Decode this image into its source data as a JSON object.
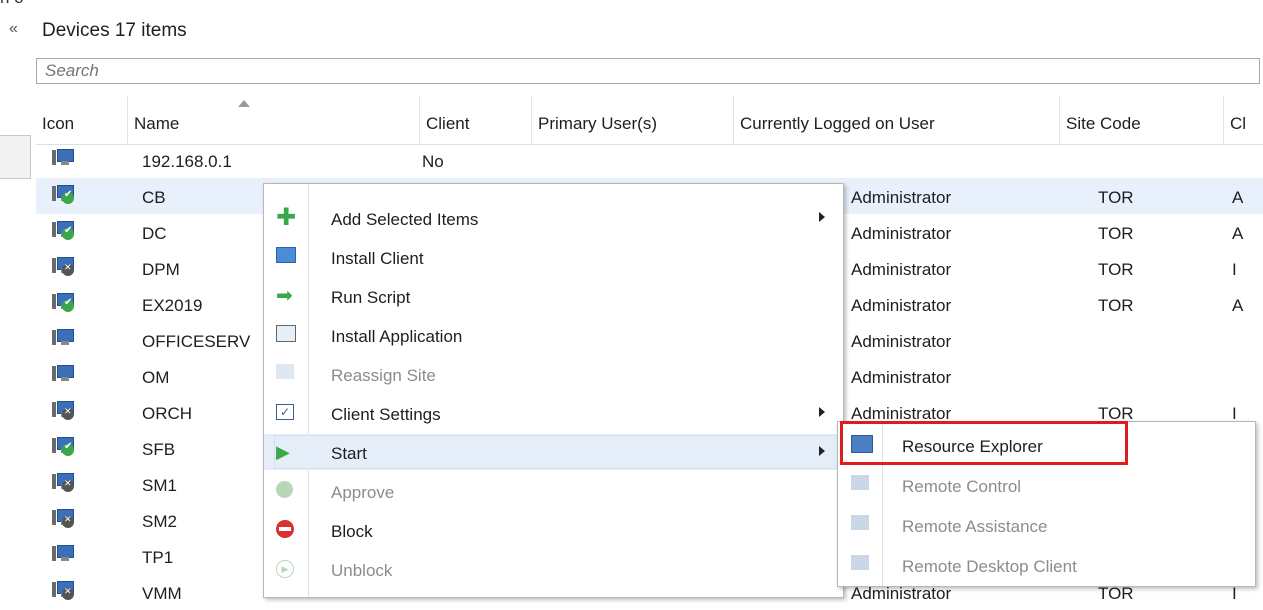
{
  "window": {
    "cut_text": "n   o"
  },
  "header": {
    "title": "Devices 17 items",
    "collapse_glyph": "«"
  },
  "search": {
    "placeholder": "Search"
  },
  "columns": [
    "Icon",
    "Name",
    "Client",
    "Primary User(s)",
    "Currently Logged on User",
    "Site Code",
    "Cl"
  ],
  "rows": [
    {
      "status": "none",
      "name": "192.168.0.1",
      "client": "No",
      "logged": "",
      "site": "",
      "extra": ""
    },
    {
      "status": "ok",
      "name": "CB",
      "client": "",
      "logged": "Administrator",
      "site": "TOR",
      "extra": "A"
    },
    {
      "status": "ok",
      "name": "DC",
      "client": "",
      "logged": "Administrator",
      "site": "TOR",
      "extra": "A"
    },
    {
      "status": "err",
      "name": "DPM",
      "client": "",
      "logged": "Administrator",
      "site": "TOR",
      "extra": "I"
    },
    {
      "status": "ok",
      "name": "EX2019",
      "client": "",
      "logged": "Administrator",
      "site": "TOR",
      "extra": "A"
    },
    {
      "status": "none",
      "name": "OFFICESERV",
      "client": "",
      "logged": "Administrator",
      "site": "",
      "extra": ""
    },
    {
      "status": "none",
      "name": "OM",
      "client": "",
      "logged": "Administrator",
      "site": "",
      "extra": ""
    },
    {
      "status": "err",
      "name": "ORCH",
      "client": "",
      "logged": "Administrator",
      "site": "TOR",
      "extra": "I"
    },
    {
      "status": "ok",
      "name": "SFB",
      "client": "",
      "logged": "",
      "site": "",
      "extra": ""
    },
    {
      "status": "err",
      "name": "SM1",
      "client": "",
      "logged": "",
      "site": "",
      "extra": ""
    },
    {
      "status": "err",
      "name": "SM2",
      "client": "",
      "logged": "",
      "site": "",
      "extra": ""
    },
    {
      "status": "none",
      "name": "TP1",
      "client": "",
      "logged": "",
      "site": "",
      "extra": ""
    },
    {
      "status": "err",
      "name": "VMM",
      "client": "",
      "logged": "Administrator",
      "site": "TOR",
      "extra": "I"
    }
  ],
  "context_menu": {
    "items": [
      {
        "label": "Add Selected Items",
        "icon": "plus-icon",
        "submenu": true,
        "disabled": false
      },
      {
        "label": "Install Client",
        "icon": "install-client-icon",
        "submenu": false,
        "disabled": false
      },
      {
        "label": "Run Script",
        "icon": "arrow-right-icon",
        "submenu": false,
        "disabled": false
      },
      {
        "label": "Install Application",
        "icon": "install-app-icon",
        "submenu": false,
        "disabled": false
      },
      {
        "label": "Reassign Site",
        "icon": "reassign-icon",
        "submenu": false,
        "disabled": true
      },
      {
        "label": "Client Settings",
        "icon": "checkbox-settings-icon",
        "submenu": true,
        "disabled": false
      },
      {
        "label": "Start",
        "icon": "play-icon",
        "submenu": true,
        "disabled": false
      },
      {
        "label": "Approve",
        "icon": "approve-icon",
        "submenu": false,
        "disabled": true
      },
      {
        "label": "Block",
        "icon": "block-icon",
        "submenu": false,
        "disabled": false
      },
      {
        "label": "Unblock",
        "icon": "unblock-icon",
        "submenu": false,
        "disabled": true
      }
    ]
  },
  "start_submenu": {
    "items": [
      {
        "label": "Resource Explorer",
        "icon": "resource-explorer-icon",
        "disabled": false
      },
      {
        "label": "Remote Control",
        "icon": "remote-control-icon",
        "disabled": true
      },
      {
        "label": "Remote Assistance",
        "icon": "remote-assistance-icon",
        "disabled": true
      },
      {
        "label": "Remote Desktop Client",
        "icon": "remote-desktop-icon",
        "disabled": true
      }
    ]
  },
  "colors": {
    "highlight": "#e01b1b",
    "selected_row": "#e8f0fb",
    "menu_hover": "#e5eef8"
  }
}
